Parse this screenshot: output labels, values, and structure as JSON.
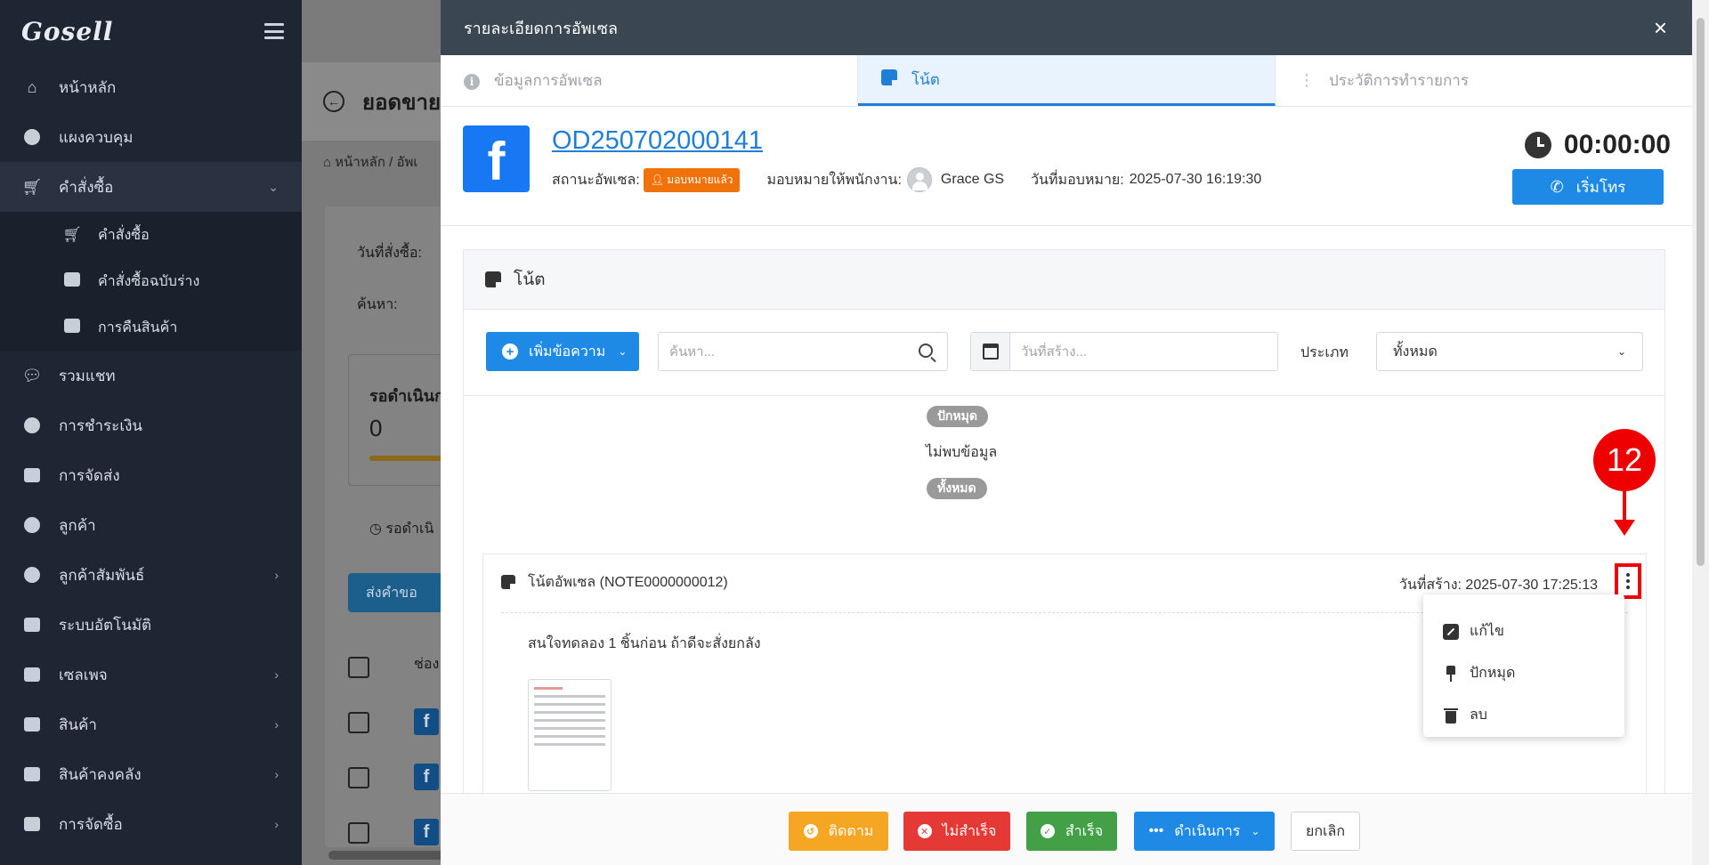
{
  "sidebar": {
    "logo": "Gosell",
    "items": [
      {
        "label": "หน้าหลัก",
        "icon": "home-icon"
      },
      {
        "label": "แผงควบคุม",
        "icon": "dashboard-icon"
      },
      {
        "label": "คำสั่งซื้อ",
        "icon": "cart-icon"
      },
      {
        "label": "คำสั่งซื้อ",
        "icon": "cart-icon"
      },
      {
        "label": "คำสั่งซื้อฉบับร่าง",
        "icon": "draft-icon"
      },
      {
        "label": "การคืนสินค้า",
        "icon": "return-icon"
      },
      {
        "label": "รวมแชท",
        "icon": "chat-icon"
      },
      {
        "label": "การชำระเงิน",
        "icon": "money-bag-icon"
      },
      {
        "label": "การจัดส่ง",
        "icon": "truck-icon"
      },
      {
        "label": "ลูกค้า",
        "icon": "users-icon"
      },
      {
        "label": "ลูกค้าสัมพันธ์",
        "icon": "crm-icon"
      },
      {
        "label": "ระบบอัตโนมัติ",
        "icon": "robot-icon"
      },
      {
        "label": "เซลเพจ",
        "icon": "salepage-icon"
      },
      {
        "label": "สินค้า",
        "icon": "boxes-icon"
      },
      {
        "label": "สินค้าคงคลัง",
        "icon": "warehouse-icon"
      },
      {
        "label": "การจัดซื้อ",
        "icon": "purchase-icon"
      }
    ]
  },
  "background": {
    "title": "ยอดขายอั",
    "breadcrumb": "หน้าหลัก / อัพเ",
    "order_date_label": "วันที่สั่งซื้อ:",
    "search_label": "ค้นหา:",
    "pending_label": "รอดำเนินก",
    "pending_value": "0",
    "pending_tab": "รอดำเนิ",
    "send_button": "ส่งคำขอ",
    "column_label": "ช่อง"
  },
  "drawer": {
    "title": "รายละเอียดการอัพเซล",
    "close": "×",
    "tabs": [
      {
        "label": "ข้อมูลการอัพเซล"
      },
      {
        "label": "โน้ต"
      },
      {
        "label": "ประวัติการทำรายการ"
      }
    ],
    "order": {
      "id": "OD250702000141",
      "status_label": "สถานะอัพเซล:",
      "status_badge": "มอบหมายแล้ว",
      "assign_label": "มอบหมายให้พนักงาน:",
      "assignee": "Grace GS",
      "assign_date_label": "วันที่มอบหมาย:",
      "assign_date": "2025-07-30 16:19:30",
      "timer": "00:00:00",
      "call_button": "เริ่มโทร"
    },
    "notes": {
      "title": "โน้ต",
      "add_button": "เพิ่มข้อความ",
      "search_placeholder": "ค้นหา...",
      "date_placeholder": "วันที่สร้าง...",
      "type_label": "ประเภท",
      "type_value": "ทั้งหมด",
      "pinned_badge": "ปักหมุด",
      "empty_text": "ไม่พบข้อมูล",
      "all_badge": "ทั้งหมด",
      "card": {
        "title": "โน้ตอัพเซล (NOTE0000000012)",
        "created_label": "วันที่สร้าง:",
        "created_date": "2025-07-30 17:25:13",
        "body": "สนใจทดลอง 1 ชิ้นก่อน ถ้าดีจะสั่งยกลัง"
      },
      "menu": [
        {
          "label": "แก้ไข",
          "icon": "edit-icon"
        },
        {
          "label": "ปักหมุด",
          "icon": "pin-icon"
        },
        {
          "label": "ลบ",
          "icon": "trash-icon"
        }
      ]
    },
    "callout_number": "12",
    "footer": {
      "follow": "ติดตาม",
      "fail": "ไม่สำเร็จ",
      "success": "สำเร็จ",
      "action": "ดำเนินการ",
      "cancel": "ยกเลิก"
    }
  },
  "colors": {
    "primary": "#1f8ae6",
    "sidebar_bg": "#1f2633",
    "drawer_header": "#3a4652",
    "assigned_badge": "#f0720a",
    "follow": "#f5a623",
    "fail": "#e53935",
    "success": "#43a047",
    "callout": "#e00000"
  }
}
